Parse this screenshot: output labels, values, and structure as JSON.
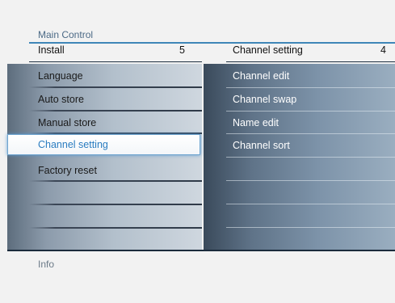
{
  "breadcrumb": "Main Control",
  "header": {
    "left_label": "Install",
    "left_count": "5",
    "right_label": "Channel setting",
    "right_count": "4"
  },
  "left_menu": {
    "items": [
      {
        "label": "Language"
      },
      {
        "label": "Auto store"
      },
      {
        "label": "Manual store"
      },
      {
        "label": "Channel setting",
        "selected": true
      },
      {
        "label": "Factory reset"
      }
    ]
  },
  "right_menu": {
    "items": [
      {
        "label": "Channel edit"
      },
      {
        "label": "Channel swap"
      },
      {
        "label": "Name edit"
      },
      {
        "label": "Channel sort"
      }
    ]
  },
  "footer": {
    "info_label": "Info"
  },
  "colors": {
    "accent": "#2a7cc0",
    "rule": "#3f86b8"
  }
}
